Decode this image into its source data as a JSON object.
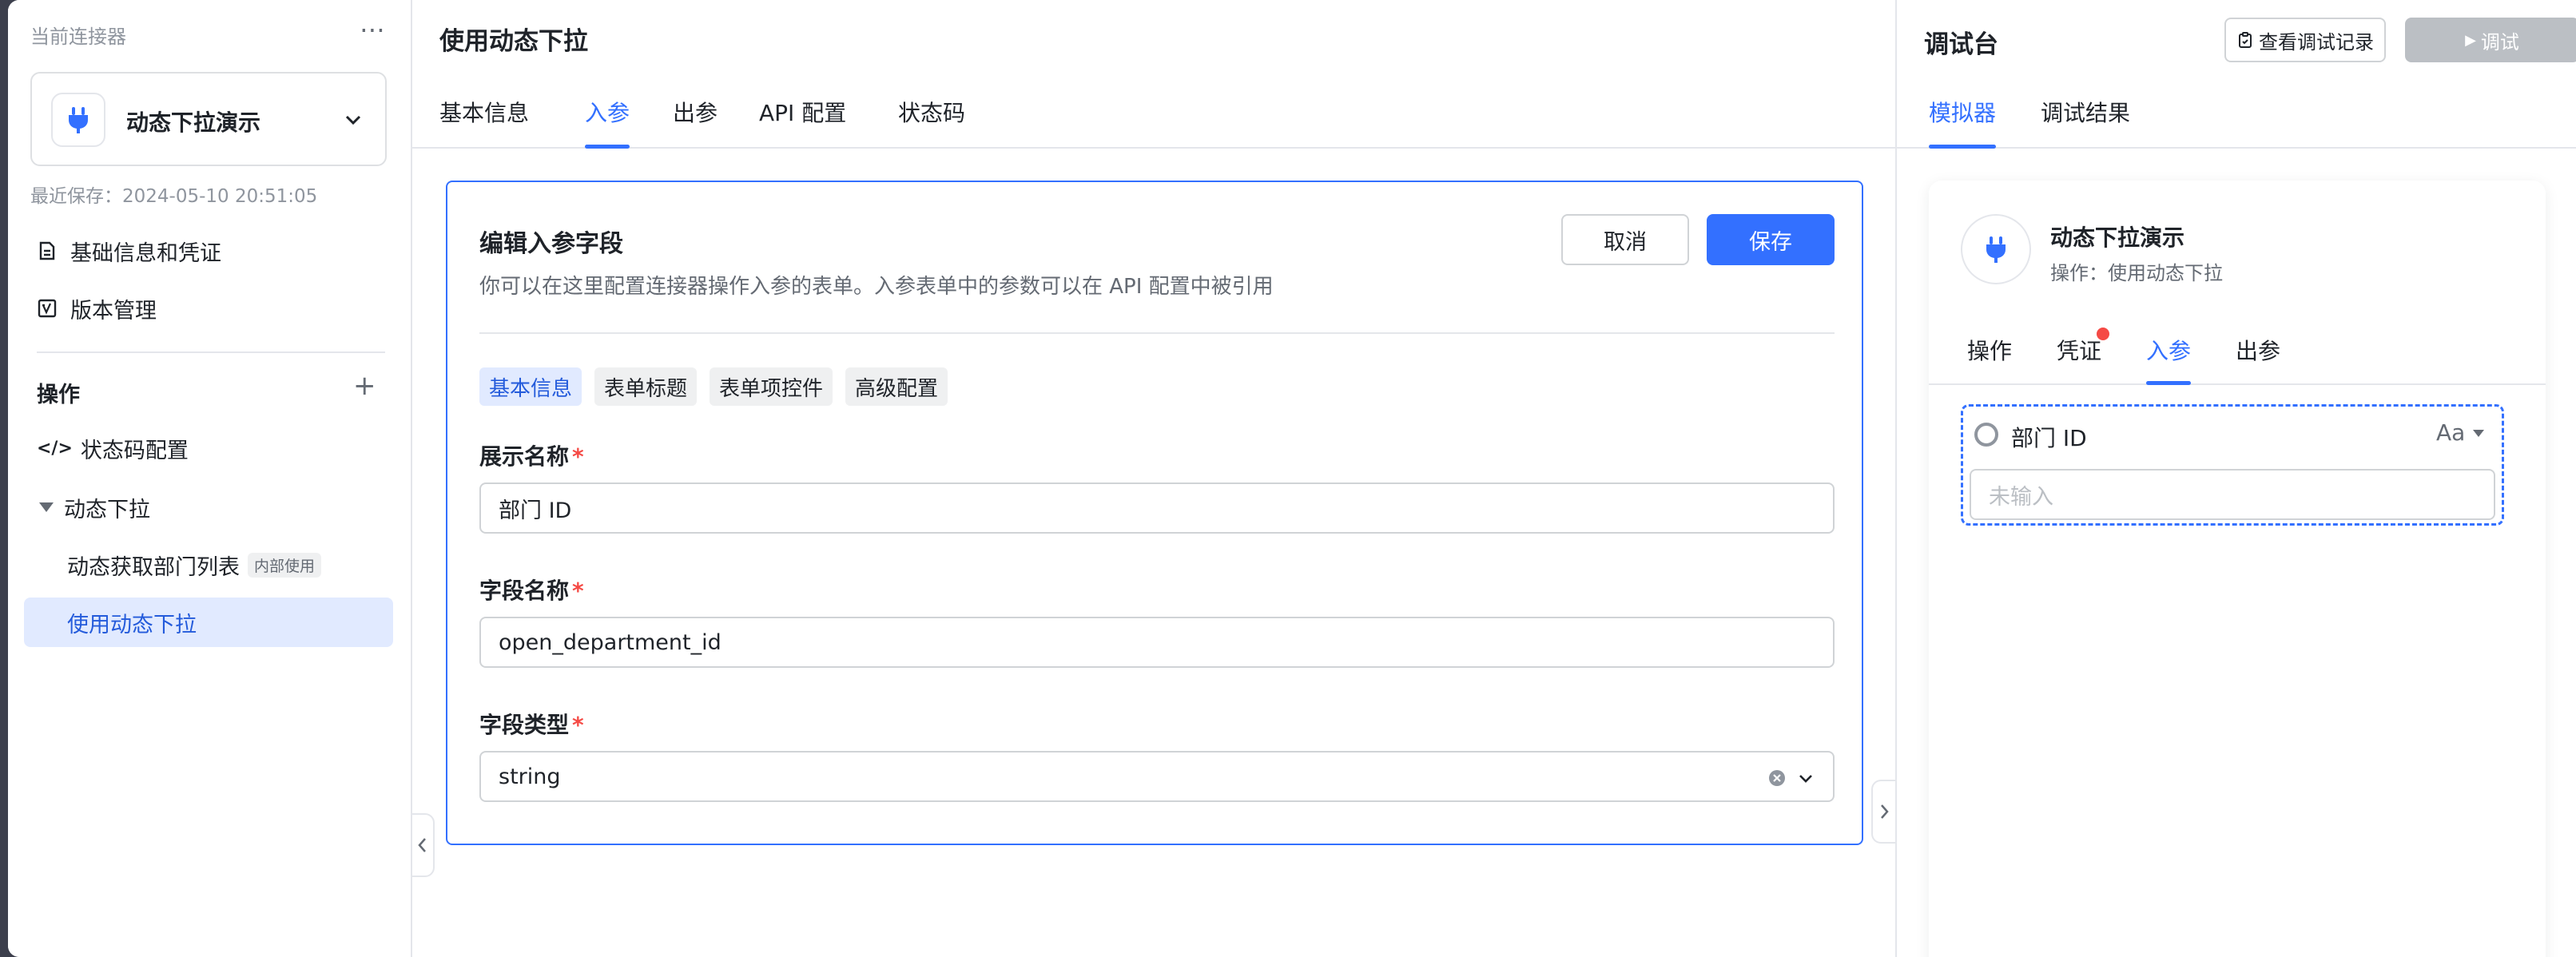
{
  "sidebar": {
    "header": "当前连接器",
    "connector_name": "动态下拉演示",
    "saved": "最近保存：2024-05-10 20:51:05",
    "nav": [
      {
        "label": "基础信息和凭证",
        "icon": "document-icon"
      },
      {
        "label": "版本管理",
        "icon": "version-icon"
      }
    ],
    "section": "操作",
    "items": [
      {
        "label": "状态码配置",
        "icon": "code-icon"
      },
      {
        "label": "动态下拉",
        "icon": "caret-down-icon"
      },
      {
        "label": "动态获取部门列表",
        "tag": "内部使用"
      },
      {
        "label": "使用动态下拉"
      }
    ]
  },
  "main": {
    "title": "使用动态下拉",
    "tabs": [
      "基本信息",
      "入参",
      "出参",
      "API 配置",
      "状态码"
    ],
    "active_tab": "入参",
    "editor": {
      "title": "编辑入参字段",
      "desc": "你可以在这里配置连接器操作入参的表单。入参表单中的参数可以在 API 配置中被引用",
      "cancel": "取消",
      "save": "保存",
      "chips": [
        "基本信息",
        "表单标题",
        "表单项控件",
        "高级配置"
      ],
      "fields": [
        {
          "label": "展示名称",
          "required": "*",
          "value": "部门 ID"
        },
        {
          "label": "字段名称",
          "required": "*",
          "value": "open_department_id"
        },
        {
          "label": "字段类型",
          "required": "*",
          "value": "string"
        }
      ]
    }
  },
  "right": {
    "title": "调试台",
    "history_btn": "查看调试记录",
    "debug_btn": "调试",
    "tabs": [
      "模拟器",
      "调试结果"
    ],
    "active_tab": "模拟器",
    "sim": {
      "name": "动态下拉演示",
      "sub": "操作：使用动态下拉",
      "tabs": [
        "操作",
        "凭证",
        "入参",
        "出参"
      ],
      "active_tab": "入参",
      "field_label": "部门 ID",
      "type_badge": "Aa",
      "placeholder": "未输入"
    }
  },
  "colors": {
    "accent": "#3370ff",
    "active_bg": "#e1eaff",
    "required": "#f54a45",
    "disabled_btn": "#bbbfc4"
  }
}
